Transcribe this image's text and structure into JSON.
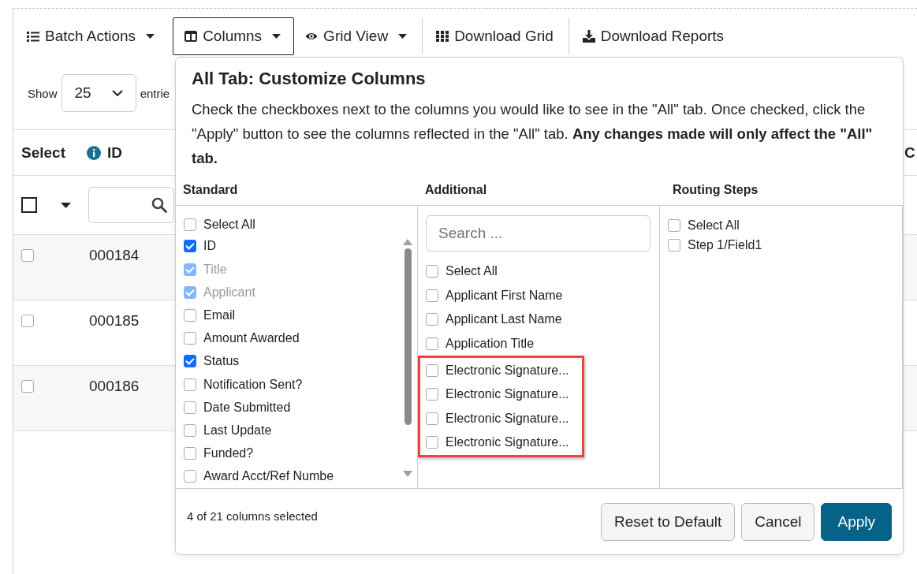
{
  "toolbar": [
    {
      "label": "Batch Actions",
      "caret": true,
      "selected": false
    },
    {
      "label": "Columns",
      "caret": true,
      "selected": true
    },
    {
      "label": "Grid View",
      "caret": true,
      "selected": false
    },
    {
      "label": "Download Grid",
      "caret": false,
      "selected": false
    },
    {
      "label": "Download Reports",
      "caret": false,
      "selected": false
    }
  ],
  "length_menu": {
    "show_label": "Show",
    "value": "25",
    "entries_label": "entrie"
  },
  "table": {
    "columns": [
      "Select",
      "ID",
      "C"
    ],
    "select_all_checked": false,
    "rows": [
      {
        "id": "000184",
        "checked": false
      },
      {
        "id": "000185",
        "checked": false
      },
      {
        "id": "000186",
        "checked": false
      }
    ]
  },
  "popover": {
    "title": "All Tab: Customize Columns",
    "description": "Check the checkboxes next to the columns you would like to see in the \"All\" tab. Once checked, click the \"Apply\" button to see the columns reflected in the \"All\" tab. **Any changes made will only affect the \"All\" tab.**",
    "groups": [
      {
        "heading": "Standard",
        "items": [
          {
            "label": "Select All",
            "checked": false,
            "disabled": false,
            "highlighted": false
          },
          {
            "label": "ID",
            "checked": true,
            "disabled": false,
            "highlighted": false
          },
          {
            "label": "Title",
            "checked": true,
            "disabled": true,
            "highlighted": false
          },
          {
            "label": "Applicant",
            "checked": true,
            "disabled": true,
            "highlighted": false
          },
          {
            "label": "Email",
            "checked": false,
            "disabled": false,
            "highlighted": false
          },
          {
            "label": "Amount Awarded",
            "checked": false,
            "disabled": false,
            "highlighted": false
          },
          {
            "label": "Status",
            "checked": true,
            "disabled": false,
            "highlighted": false
          },
          {
            "label": "Notification Sent?",
            "checked": false,
            "disabled": false,
            "highlighted": false
          },
          {
            "label": "Date Submitted",
            "checked": false,
            "disabled": false,
            "highlighted": false
          },
          {
            "label": "Last Update",
            "checked": false,
            "disabled": false,
            "highlighted": false
          },
          {
            "label": "Funded?",
            "checked": false,
            "disabled": false,
            "highlighted": false
          },
          {
            "label": "Award Acct/Ref Numbe",
            "checked": false,
            "disabled": false,
            "highlighted": false
          }
        ]
      },
      {
        "heading": "Additional",
        "search": {
          "placeholder": "Search ..."
        },
        "items": [
          {
            "label": "Select All",
            "checked": false,
            "disabled": false,
            "highlighted": false
          },
          {
            "label": "Applicant First Name",
            "checked": false,
            "disabled": false,
            "highlighted": false
          },
          {
            "label": "Applicant Last Name",
            "checked": false,
            "disabled": false,
            "highlighted": false
          },
          {
            "label": "Application Title",
            "checked": false,
            "disabled": false,
            "highlighted": false
          },
          {
            "label": "Electronic Signature...",
            "checked": false,
            "disabled": false,
            "highlighted": true
          },
          {
            "label": "Electronic Signature...",
            "checked": false,
            "disabled": false,
            "highlighted": true
          },
          {
            "label": "Electronic Signature...",
            "checked": false,
            "disabled": false,
            "highlighted": true
          },
          {
            "label": "Electronic Signature...",
            "checked": false,
            "disabled": false,
            "highlighted": true
          }
        ]
      },
      {
        "heading": "Routing Steps",
        "items": [
          {
            "label": "Select All",
            "checked": false,
            "disabled": false,
            "highlighted": false
          },
          {
            "label": "Step 1/Field1",
            "checked": false,
            "disabled": false,
            "highlighted": false
          }
        ]
      }
    ],
    "summary": "4 of 21 columns selected",
    "buttons": [
      {
        "label": "Reset to Default",
        "kind": "secondary"
      },
      {
        "label": "Cancel",
        "kind": "secondary"
      },
      {
        "label": "Apply",
        "kind": "primary"
      }
    ]
  }
}
